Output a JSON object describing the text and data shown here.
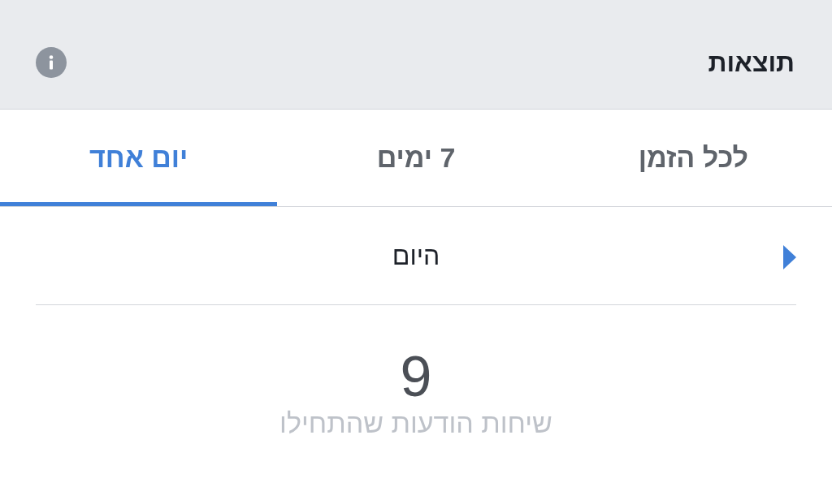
{
  "header": {
    "title": "תוצאות"
  },
  "tabs": [
    {
      "label": "לכל הזמן",
      "selected": false
    },
    {
      "label": "7 ימים",
      "selected": false
    },
    {
      "label": "יום אחד",
      "selected": true
    }
  ],
  "period": {
    "label": "היום"
  },
  "metric": {
    "value": "9",
    "label": "שיחות הודעות שהתחילו"
  }
}
